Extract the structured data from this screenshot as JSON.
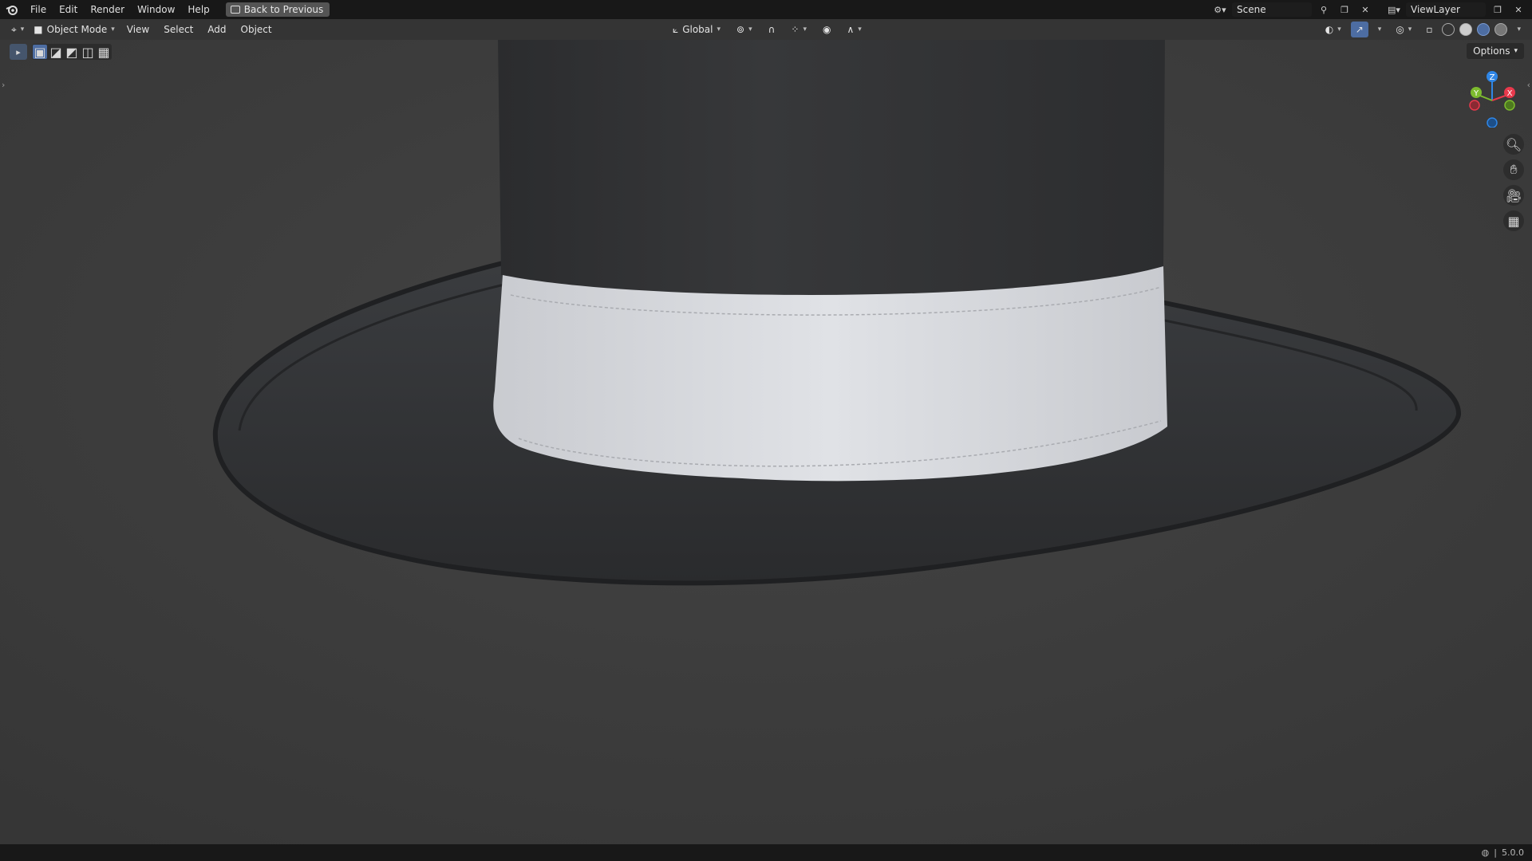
{
  "topbar": {
    "menus": [
      "File",
      "Edit",
      "Render",
      "Window",
      "Help"
    ],
    "back_label": "Back to Previous",
    "scene_name": "Scene",
    "view_layer_name": "ViewLayer"
  },
  "header": {
    "mode_label": "Object Mode",
    "menus": [
      "View",
      "Select",
      "Add",
      "Object"
    ],
    "orientation_label": "Global"
  },
  "viewport": {
    "options_label": "Options",
    "gizmo_axes": {
      "x": "X",
      "y": "Y",
      "z": "Z"
    },
    "colors": {
      "background": "#3c3c3c",
      "hat": "#2e2f31",
      "band": "#d9dbe0",
      "x_axis": "#e8394c",
      "y_axis": "#7dbb2e",
      "z_axis": "#2f86e6"
    }
  },
  "statusbar": {
    "version": "5.0.0"
  }
}
